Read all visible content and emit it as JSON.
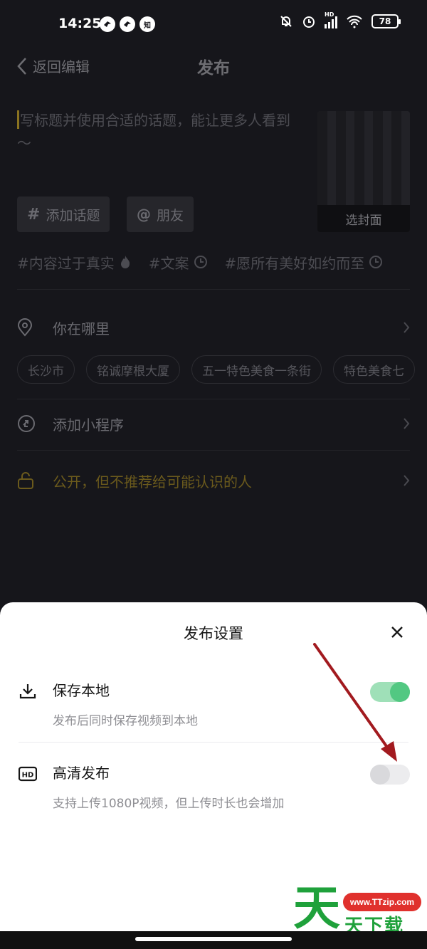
{
  "status": {
    "time": "14:25",
    "app_badge": "知",
    "hd_label": "HD",
    "battery": "78"
  },
  "nav": {
    "back_label": "返回编辑",
    "title": "发布"
  },
  "caption": {
    "placeholder": "写标题并使用合适的话题，能让更多人看到～"
  },
  "cover": {
    "button_label": "选封面"
  },
  "chips": {
    "topic_label": "添加话题",
    "friend_label": "朋友"
  },
  "hot_topics": [
    "#内容过于真实",
    "#文案",
    "#愿所有美好如约而至"
  ],
  "location": {
    "label": "你在哪里",
    "suggestions": [
      "长沙市",
      "铭诚摩根大厦",
      "五一特色美食一条街",
      "特色美食七"
    ]
  },
  "mini_program": {
    "label": "添加小程序"
  },
  "privacy": {
    "label": "公开，但不推荐给可能认识的人",
    "color": "#6b5a1c"
  },
  "sheet": {
    "title": "发布设置",
    "settings": [
      {
        "label": "保存本地",
        "description": "发布后同时保存视频到本地",
        "icon": "download-icon",
        "enabled": true
      },
      {
        "label": "高清发布",
        "description": "支持上传1080P视频，但上传时长也会增加",
        "icon": "hd-icon",
        "enabled": false
      }
    ],
    "toggle_on_color": "#52c882"
  },
  "watermark": {
    "url": "www.TTzip.com",
    "big_char": "天",
    "small_text": "天下载"
  }
}
